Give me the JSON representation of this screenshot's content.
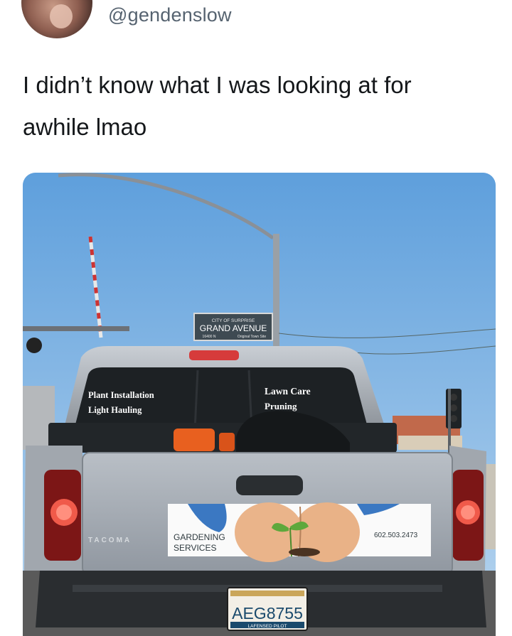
{
  "post": {
    "handle": "@gendenslow",
    "text_line1": "I didn’t know what I was looking at for",
    "text_line2": "awhile lmao"
  },
  "photo": {
    "street_sign": {
      "city": "CITY OF SURPRISE",
      "street": "GRAND AVENUE",
      "number": "16400 N",
      "subtitle": "Original Town Site"
    },
    "window_left": [
      "Plant Installation",
      "Light Hauling"
    ],
    "window_right": [
      "Lawn Care",
      "Pruning"
    ],
    "tailgate_ad": {
      "line1": "GARDENING",
      "line2": "SERVICES",
      "phone": "602.503.2473"
    },
    "brand": "TACOMA",
    "license_plate": "AEG8755",
    "plate_bottom": "LAFENSED PILOT"
  }
}
